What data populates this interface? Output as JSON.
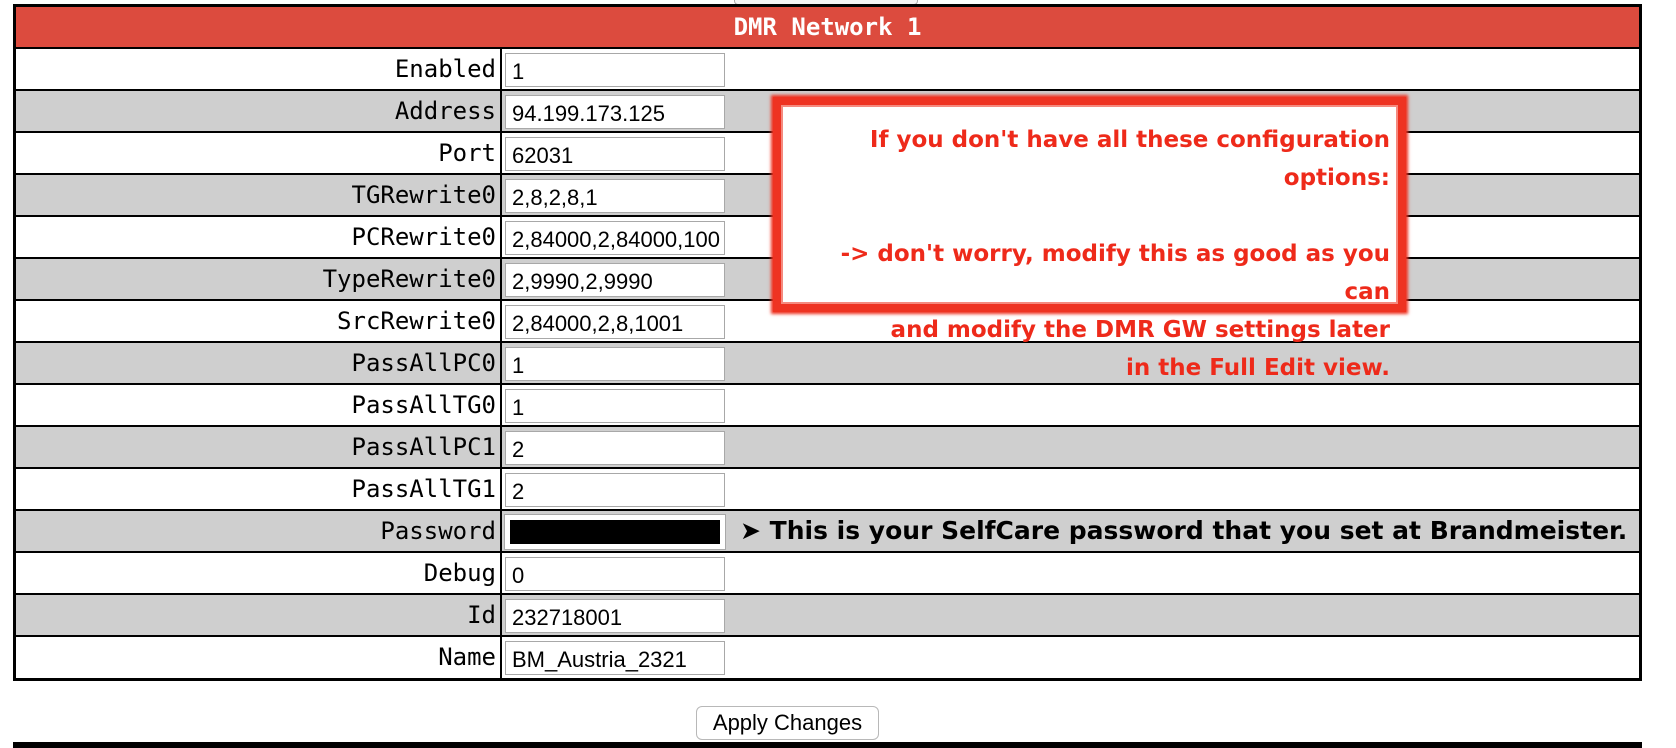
{
  "section": {
    "title": "DMR Network 1"
  },
  "fields": [
    {
      "label": "Enabled",
      "value": "1"
    },
    {
      "label": "Address",
      "value": "94.199.173.125"
    },
    {
      "label": "Port",
      "value": "62031"
    },
    {
      "label": "TGRewrite0",
      "value": "2,8,2,8,1"
    },
    {
      "label": "PCRewrite0",
      "value": "2,84000,2,84000,100"
    },
    {
      "label": "TypeRewrite0",
      "value": "2,9990,2,9990"
    },
    {
      "label": "SrcRewrite0",
      "value": "2,84000,2,8,1001"
    },
    {
      "label": "PassAllPC0",
      "value": "1"
    },
    {
      "label": "PassAllTG0",
      "value": "1"
    },
    {
      "label": "PassAllPC1",
      "value": "2"
    },
    {
      "label": "PassAllTG1",
      "value": "2"
    },
    {
      "label": "Password",
      "value": ""
    },
    {
      "label": "Debug",
      "value": "0"
    },
    {
      "label": "Id",
      "value": "232718001"
    },
    {
      "label": "Name",
      "value": "BM_Austria_2321"
    }
  ],
  "password_hint": "➤ This is your SelfCare password that you set at Brandmeister.",
  "callout": {
    "line1": "If you don't have all these configuration options:",
    "line2": "-> don't worry, modify this as good as you can",
    "line3": "and modify the DMR GW settings later",
    "line4": "in the Full Edit view.",
    "color": "#ee2a1a"
  },
  "apply_button": {
    "label": "Apply Changes"
  },
  "colors": {
    "header_bg": "#dc4b3e",
    "row_alt_bg": "#cfcfcf"
  }
}
